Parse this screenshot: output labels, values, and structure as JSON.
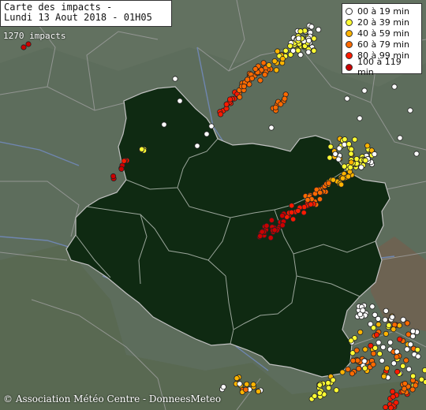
{
  "title": {
    "line1": "Carte des impacts -",
    "line2": "Lundi 13 Aout 2018 - 01H05"
  },
  "impact_count": "1270 impacts",
  "legend": [
    {
      "label": "00 à 19 min",
      "color": "#ffffff"
    },
    {
      "label": "20 à 39 min",
      "color": "#ffff33"
    },
    {
      "label": "40 à 59 min",
      "color": "#ffb400"
    },
    {
      "label": "60 à 79 min",
      "color": "#ff6a00"
    },
    {
      "label": "80 à 99 min",
      "color": "#ff1a00"
    },
    {
      "label": "100 à 119 min",
      "color": "#cc0000"
    }
  ],
  "copyright": "© Association Météo Centre - DonneesMeteo",
  "colors": {
    "background": "#5f6f5f",
    "region_fill": "#0f2a12",
    "river": "#6f86b0",
    "border": "#9a9a9a"
  }
}
